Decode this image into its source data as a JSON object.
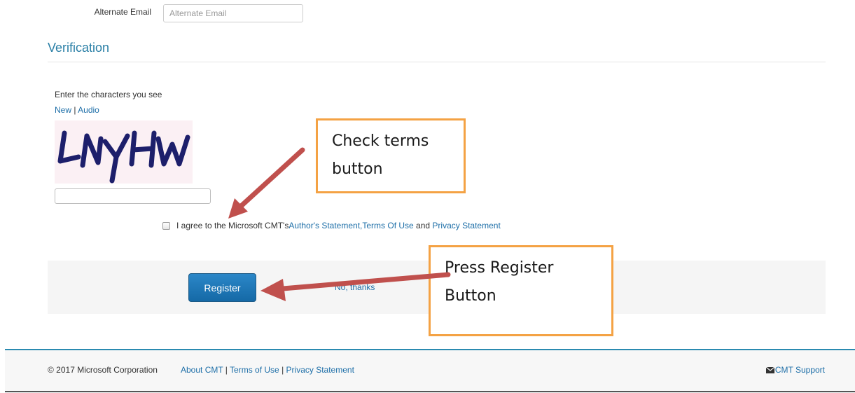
{
  "form": {
    "alternate_email_label": "Alternate Email",
    "alternate_email_placeholder": "Alternate Email",
    "alternate_email_value": ""
  },
  "verification": {
    "title": "Verification",
    "prompt": "Enter the characters you see",
    "new_link": "New",
    "separator": " | ",
    "audio_link": "Audio",
    "captcha_text": "LNYHW",
    "captcha_input_value": ""
  },
  "terms": {
    "checked": false,
    "text_before": "I agree to the Microsoft CMT's ",
    "authors_statement": "Author's Statement,",
    "terms_of_use": " Terms Of Use",
    "and": " and ",
    "privacy_statement": "Privacy Statement"
  },
  "actions": {
    "register_label": "Register",
    "no_thanks_label": "No, thanks"
  },
  "footer": {
    "copyright": "© 2017 Microsoft Corporation",
    "about": "About CMT",
    "separator": " | ",
    "terms": "Terms of Use",
    "privacy": "Privacy Statement",
    "support": "CMT Support",
    "support_icon": "envelope-icon"
  },
  "annotations": {
    "callout_1": [
      "Check terms",
      "button"
    ],
    "callout_2": [
      "Press Register",
      "Button"
    ],
    "border_color": "#f4a244",
    "arrow_color": "#c0504d"
  },
  "colors": {
    "link": "#1e6fa8",
    "section_title": "#2a7fa6",
    "button": "#1569a6",
    "footer_border": "#2a8ab0"
  }
}
